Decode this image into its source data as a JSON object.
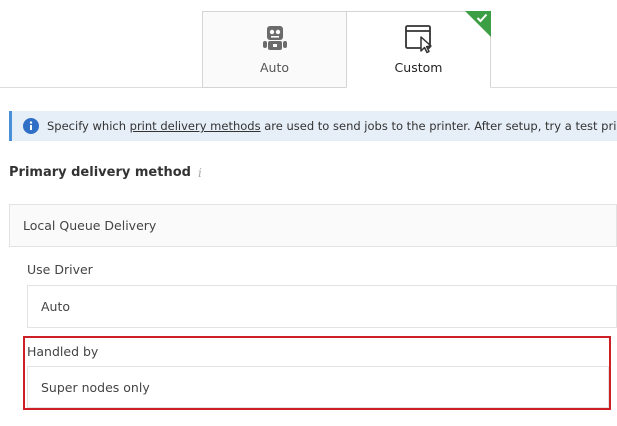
{
  "tabs": [
    {
      "label": "Auto",
      "icon": "robot-icon",
      "selected": false
    },
    {
      "label": "Custom",
      "icon": "window-cursor-icon",
      "selected": true
    }
  ],
  "info": {
    "text_before": "Specify which ",
    "link": "print delivery methods",
    "text_after": " are used to send jobs to the printer. After setup, try a test print."
  },
  "primary": {
    "title": "Primary delivery method",
    "hint_icon": "i",
    "value": "Local Queue Delivery"
  },
  "driver": {
    "label": "Use Driver",
    "value": "Auto"
  },
  "handled": {
    "label": "Handled by",
    "value": "Super nodes only"
  },
  "colors": {
    "accent_green": "#3c9e45",
    "info_blue": "#2f6fc6",
    "highlight_red": "#cc1f26"
  }
}
